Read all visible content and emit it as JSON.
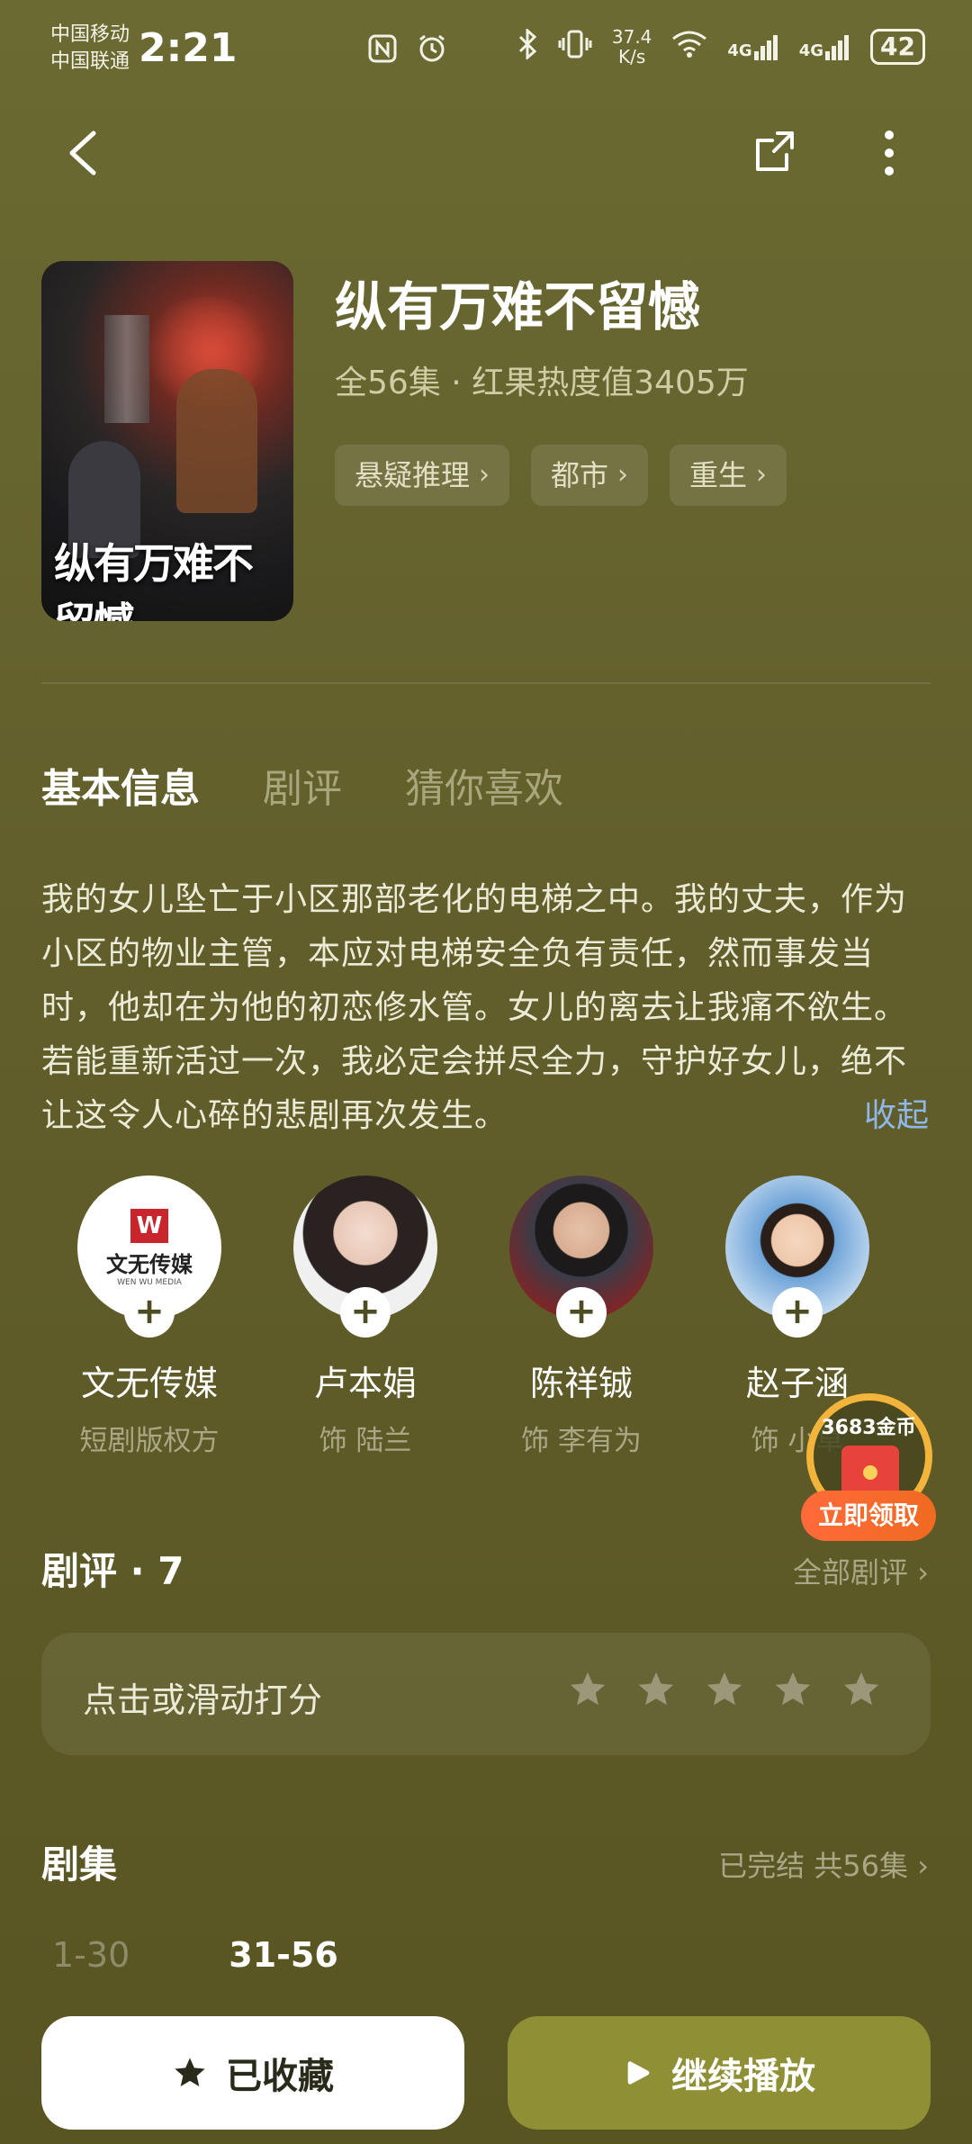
{
  "status": {
    "carrier1": "中国移动",
    "carrier2": "中国联通",
    "time": "2:21",
    "speed_value": "37.4",
    "speed_unit": "K/s",
    "network1": "4G",
    "network2": "4G",
    "battery": "42"
  },
  "drama": {
    "title": "纵有万难不留憾",
    "poster_title": "纵有万难不留憾",
    "meta": "全56集 · 红果热度值3405万",
    "tags": [
      "悬疑推理",
      "都市",
      "重生"
    ]
  },
  "tabs": [
    "基本信息",
    "剧评",
    "猜你喜欢"
  ],
  "synopsis": "我的女儿坠亡于小区那部老化的电梯之中。我的丈夫，作为小区的物业主管，本应对电梯安全负有责任，然而事发当时，他却在为他的初恋修水管。女儿的离去让我痛不欲生。若能重新活过一次，我必定会拼尽全力，守护好女儿，绝不让这令人心碎的悲剧再次发生。",
  "collapse_label": "收起",
  "cast": [
    {
      "name": "文无传媒",
      "role": "短剧版权方",
      "logo_mark": "W",
      "logo_text": "文无传媒",
      "logo_sub": "WEN WU MEDIA"
    },
    {
      "name": "卢本娟",
      "role": "饰 陆兰"
    },
    {
      "name": "陈祥铖",
      "role": "饰 李有为"
    },
    {
      "name": "赵子涵",
      "role": "饰 小草"
    }
  ],
  "coin_widget": {
    "amount": "3683金币",
    "claim_label": "立即领取"
  },
  "reviews": {
    "title": "剧评 · 7",
    "all_link": "全部剧评 ›",
    "rate_prompt": "点击或滑动打分",
    "stars": 5
  },
  "episodes": {
    "title": "剧集",
    "status_link": "已完结 共56集 ›",
    "ranges": [
      "1-30",
      "31-56"
    ]
  },
  "buttons": {
    "favorite": "已收藏",
    "play": "继续播放"
  }
}
